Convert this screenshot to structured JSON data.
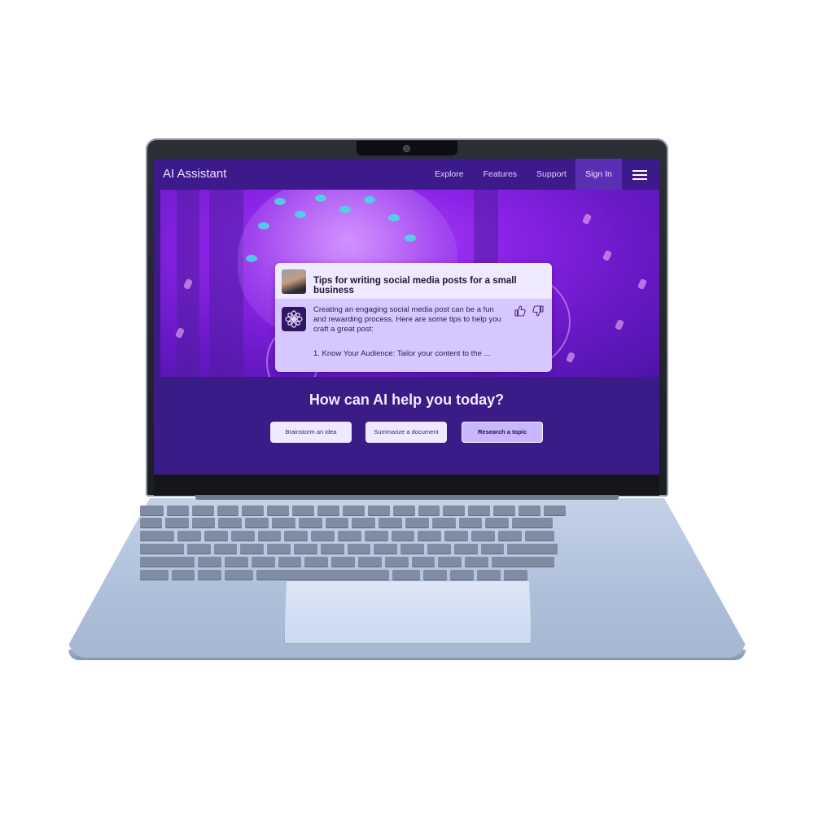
{
  "nav": {
    "brand": "AI Assistant",
    "links": [
      "Explore",
      "Features",
      "Support"
    ],
    "sign_in": "Sign In"
  },
  "chat": {
    "question": "Tips for writing social media posts for a small business",
    "answer": "Creating an engaging social media post can be a fun and rewarding process. Here are some tips to help you craft a great post:",
    "list_item": "1.   Know Your Audience: Tailor your content to the ..."
  },
  "prompt": {
    "headline": "How can AI help you today?",
    "buttons": [
      "Brainstorm an idea",
      "Summarize a document",
      "Research a topic"
    ],
    "active_button": "Research a topic"
  },
  "icons": {
    "menu": "hamburger-menu-icon",
    "like": "thumbs-up-icon",
    "dislike": "thumbs-down-icon",
    "assistant": "assistant-logo-icon"
  },
  "colors": {
    "nav_bg": "#3d1a8c",
    "sign_in_bg": "#5a2fb3",
    "page_bg": "#3b1b86",
    "active_button_bg": "#c9b6ff"
  }
}
